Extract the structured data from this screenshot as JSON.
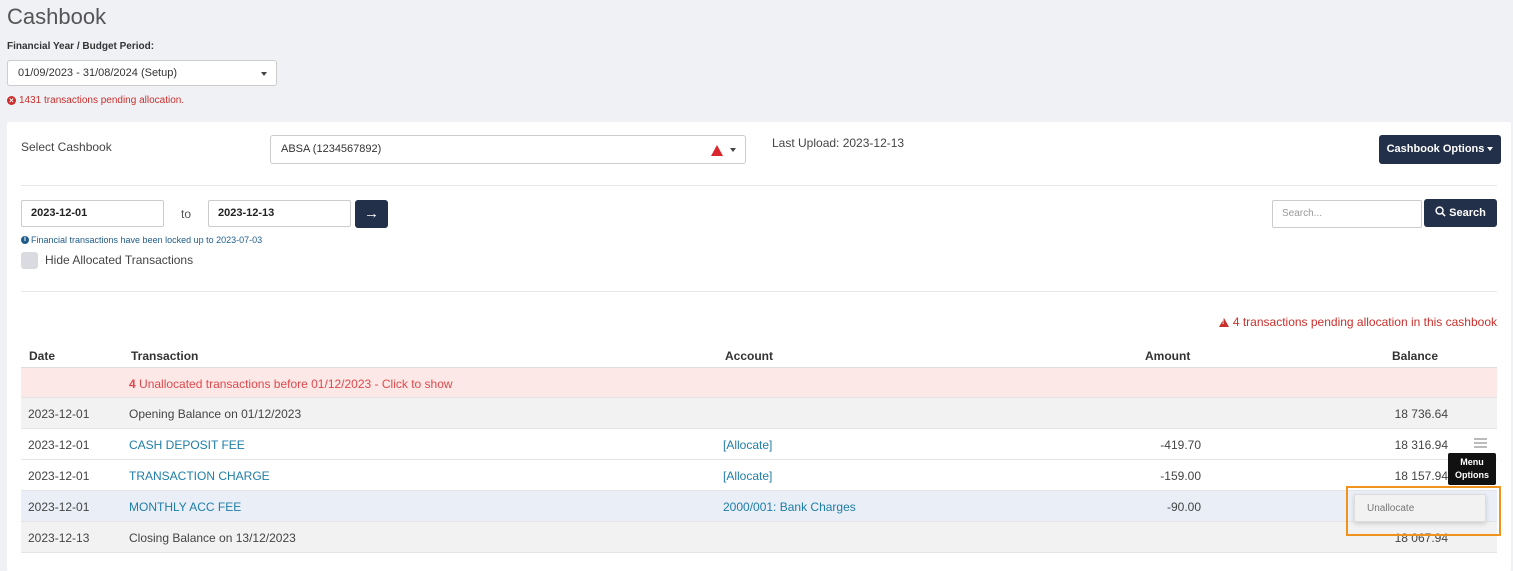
{
  "page": {
    "title": "Cashbook"
  },
  "financial_year": {
    "label": "Financial Year / Budget Period:",
    "selected": "01/09/2023 - 31/08/2024 (Setup)"
  },
  "pending_global": "1431 transactions pending allocation.",
  "cashbook": {
    "label": "Select Cashbook",
    "selected": "ABSA (1234567892)",
    "last_upload": "Last Upload: 2023-12-13",
    "options_label": "Cashbook Options"
  },
  "filters": {
    "date_from": "2023-12-01",
    "to_label": "to",
    "date_to": "2023-12-13",
    "arrow": "→",
    "search_placeholder": "Search...",
    "search_label": "Search",
    "locked_note": "Financial transactions have been locked up to 2023-07-03",
    "hide_allocated_label": "Hide Allocated Transactions"
  },
  "pending_cashbook": "4 transactions pending allocation in this cashbook",
  "table": {
    "headers": {
      "date": "Date",
      "transaction": "Transaction",
      "account": "Account",
      "amount": "Amount",
      "balance": "Balance"
    },
    "unallocated_count": "4",
    "unallocated_text": "Unallocated transactions before 01/12/2023 - Click to show",
    "rows": [
      {
        "date": "2023-12-01",
        "transaction": "Opening Balance on 01/12/2023",
        "account": "",
        "amount": "",
        "balance": "18 736.64"
      },
      {
        "date": "2023-12-01",
        "transaction": "CASH DEPOSIT FEE",
        "account": "[Allocate]",
        "amount": "-419.70",
        "balance": "18 316.94"
      },
      {
        "date": "2023-12-01",
        "transaction": "TRANSACTION CHARGE",
        "account": "[Allocate]",
        "amount": "-159.00",
        "balance": "18 157.94"
      },
      {
        "date": "2023-12-01",
        "transaction": "MONTHLY ACC FEE",
        "account": "2000/001: Bank Charges",
        "amount": "-90.00",
        "balance": ""
      },
      {
        "date": "2023-12-13",
        "transaction": "Closing Balance on 13/12/2023",
        "account": "",
        "amount": "",
        "balance": "18 067.94"
      }
    ]
  },
  "menu": {
    "tooltip_line1": "Menu",
    "tooltip_line2": "Options",
    "unallocate_label": "Unallocate"
  },
  "icons": {
    "error": "x-circle-icon",
    "warning": "warning-triangle-icon",
    "info": "info-icon",
    "search": "search-icon",
    "arrow": "arrow-right-icon",
    "menu": "hamburger-icon"
  },
  "colors": {
    "primary": "#23304a",
    "danger": "#c9302c",
    "link": "#1f7ea8",
    "highlight": "#f0921e"
  }
}
